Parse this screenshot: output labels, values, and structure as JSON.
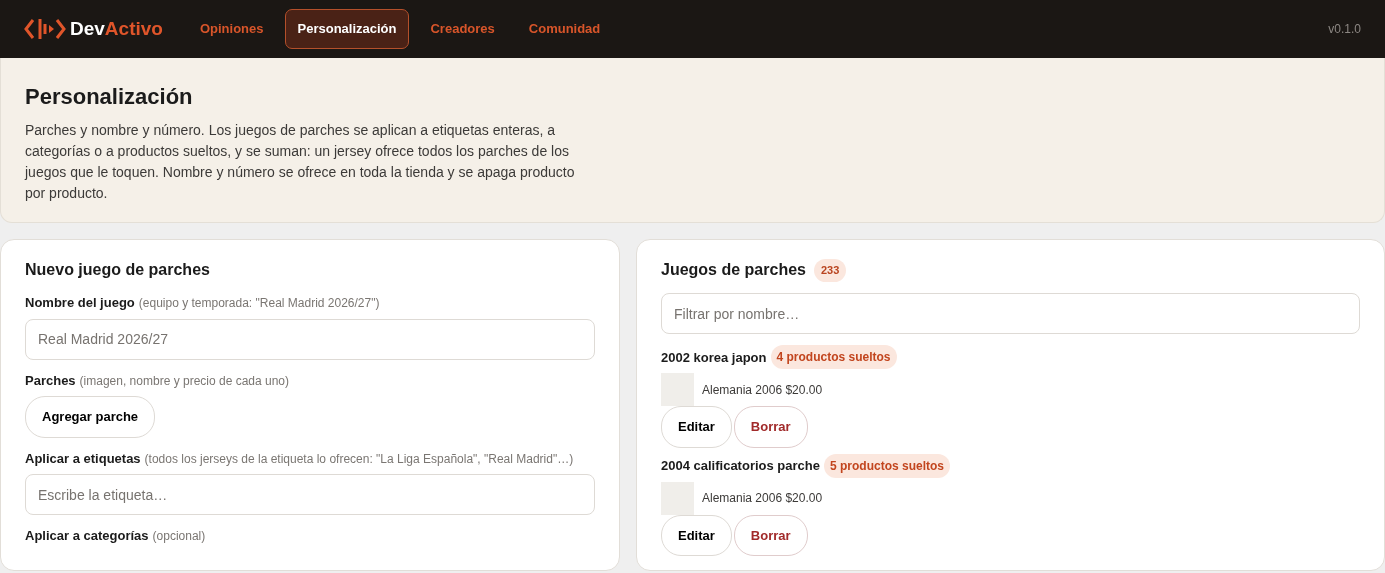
{
  "brand": {
    "first": "Dev",
    "second": "Activo"
  },
  "nav": [
    {
      "label": "Opiniones",
      "selected": false
    },
    {
      "label": "Personalización",
      "selected": true
    },
    {
      "label": "Creadores",
      "selected": false
    },
    {
      "label": "Comunidad",
      "selected": false
    }
  ],
  "version": "v0.1.0",
  "header": {
    "title": "Personalización",
    "description": "Parches y nombre y número. Los juegos de parches se aplican a etiquetas enteras, a categorías o a productos sueltos, y se suman: un jersey ofrece todos los parches de los juegos que le toquen. Nombre y número se ofrece en toda la tienda y se apaga producto por producto."
  },
  "new_set": {
    "title": "Nuevo juego de parches",
    "name_label": "Nombre del juego",
    "name_hint": "(equipo y temporada: \"Real Madrid 2026/27\")",
    "name_placeholder": "Real Madrid 2026/27",
    "patches_label": "Parches",
    "patches_hint": "(imagen, nombre y precio de cada uno)",
    "add_button": "Agregar parche",
    "tags_label": "Aplicar a etiquetas",
    "tags_hint": "(todos los jerseys de la etiqueta lo ofrecen: \"La Liga Española\", \"Real Madrid\"…)",
    "tags_placeholder": "Escribe la etiqueta…",
    "categories_label": "Aplicar a categorías",
    "categories_hint": "(opcional)"
  },
  "sets": {
    "title": "Juegos de parches",
    "count": "233",
    "filter_placeholder": "Filtrar por nombre…",
    "items": [
      {
        "name": "2002 korea japon",
        "badge": "4 productos sueltos",
        "patch": "Alemania 2006 $20.00",
        "edit": "Editar",
        "delete": "Borrar"
      },
      {
        "name": "2004 calificatorios parche",
        "badge": "5 productos sueltos",
        "patch": "Alemania 2006 $20.00",
        "edit": "Editar",
        "delete": "Borrar"
      }
    ]
  }
}
